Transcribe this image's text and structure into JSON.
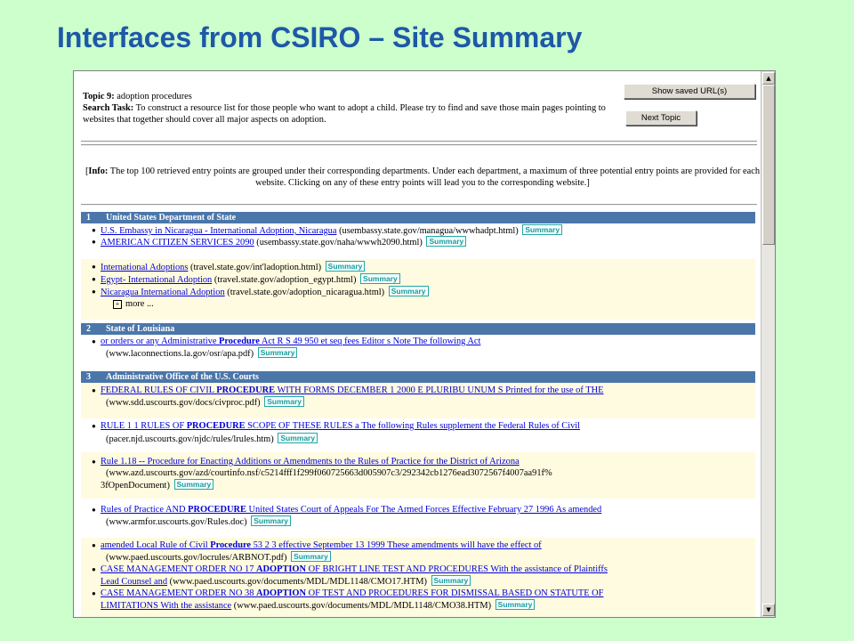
{
  "slide": {
    "title": "Interfaces from CSIRO – Site Summary"
  },
  "task": {
    "topic_label": "Topic 9:",
    "topic_text": " adoption procedures",
    "search_label": "Search Task:",
    "search_text": " To construct a resource list for those people who want to adopt a child. Please try to find and save those main pages pointing to websites that together should cover all major aspects on adoption."
  },
  "buttons": {
    "saved": "Show saved URL(s)",
    "next": "Next Topic"
  },
  "info": {
    "label": "Info:",
    "text": " The top 100 retrieved entry points are grouped under their corresponding departments. Under each department, a maximum of three potential entry points are provided for each website. Clicking on any of these entry points will lead you to the corresponding website."
  },
  "summary_label": "Summary",
  "more_label": "more ...",
  "departments": [
    {
      "num": "1",
      "name": "United States Department of State"
    },
    {
      "num": "2",
      "name": "State of Louisiana"
    },
    {
      "num": "3",
      "name": "Administrative Office of the U.S. Courts"
    }
  ],
  "entries": {
    "e1": {
      "link": "U.S. Embassy in Nicaragua - International Adoption, Nicaragua",
      "url": "(usembassy.state.gov/managua/wwwhadpt.html)"
    },
    "e2": {
      "link": "AMERICAN CITIZEN SERVICES 2090",
      "url": "(usembassy.state.gov/naha/wwwh2090.html)"
    },
    "e3": {
      "link": "International Adoptions",
      "url": "(travel.state.gov/int'ladoption.html)"
    },
    "e4": {
      "link": "Egypt- International Adoption",
      "url": "(travel.state.gov/adoption_egypt.html)"
    },
    "e5": {
      "link": "Nicaragua International Adoption",
      "url": "(travel.state.gov/adoption_nicaragua.html)"
    },
    "e6": {
      "link_pre": "or orders or any Administrative ",
      "link_bold": "Procedure",
      "link_post": " Act R S 49 950 et seq fees Editor s Note The following Act",
      "url": "(www.laconnections.la.gov/osr/apa.pdf)"
    },
    "e7": {
      "link_pre": "FEDERAL RULES OF CIVIL ",
      "link_bold": "PROCEDURE",
      "link_post": " WITH FORMS DECEMBER 1 2000 E PLURIBU UNUM S Printed for the use of THE",
      "url": "(www.sdd.uscourts.gov/docs/civproc.pdf)"
    },
    "e8": {
      "link_pre": "RULE 1 1 RULES OF ",
      "link_bold": "PROCEDURE",
      "link_post": " SCOPE OF THESE RULES a The following Rules supplement the Federal Rules of Civil",
      "url": "(pacer.njd.uscourts.gov/njdc/rules/lrules.htm)"
    },
    "e9": {
      "link": "Rule 1.18 -- Procedure for Enacting Additions or Amendments to the Rules of Practice for the District of Arizona",
      "url1": "(www.azd.uscourts.gov/azd/courtinfo.nsf/c5214fff1f299f060725663d005907c3/292342cb1276ead3072567f4007aa91f%",
      "url2": "3fOpenDocument)"
    },
    "e10": {
      "link_pre": "Rules of Practice AND ",
      "link_bold": "PROCEDURE",
      "link_post": " United States Court of Appeals For The Armed Forces Effective February 27 1996 As amended",
      "url": "(www.armfor.uscourts.gov/Rules.doc)"
    },
    "e11": {
      "link_pre": "amended Local Rule of Civil ",
      "link_bold": "Procedure",
      "link_post": " 53 2 3 effective September 13 1999 These amendments will have the effect of",
      "url": "(www.paed.uscourts.gov/locrules/ARBNOT.pdf)"
    },
    "e12": {
      "l1_pre": "CASE MANAGEMENT ORDER NO 17 ",
      "l1_bold": "ADOPTION",
      "l1_post": " OF BRIGHT LINE TEST AND PROCEDURES With the assistance of Plaintiffs",
      "l2": "Lead Counsel and",
      "url": "(www.paed.uscourts.gov/documents/MDL/MDL1148/CMO17.HTM)"
    },
    "e13": {
      "l1_pre": "CASE MANAGEMENT ORDER NO 38 ",
      "l1_bold": "ADOPTION",
      "l1_post": " OF TEST AND PROCEDURES FOR DISMISSAL BASED ON STATUTE OF",
      "l2": "LIMITATIONS With the assistance",
      "url": "(www.paed.uscourts.gov/documents/MDL/MDL1148/CMO38.HTM)"
    }
  },
  "scrollbar": {
    "up": "▲",
    "down": "▼"
  }
}
